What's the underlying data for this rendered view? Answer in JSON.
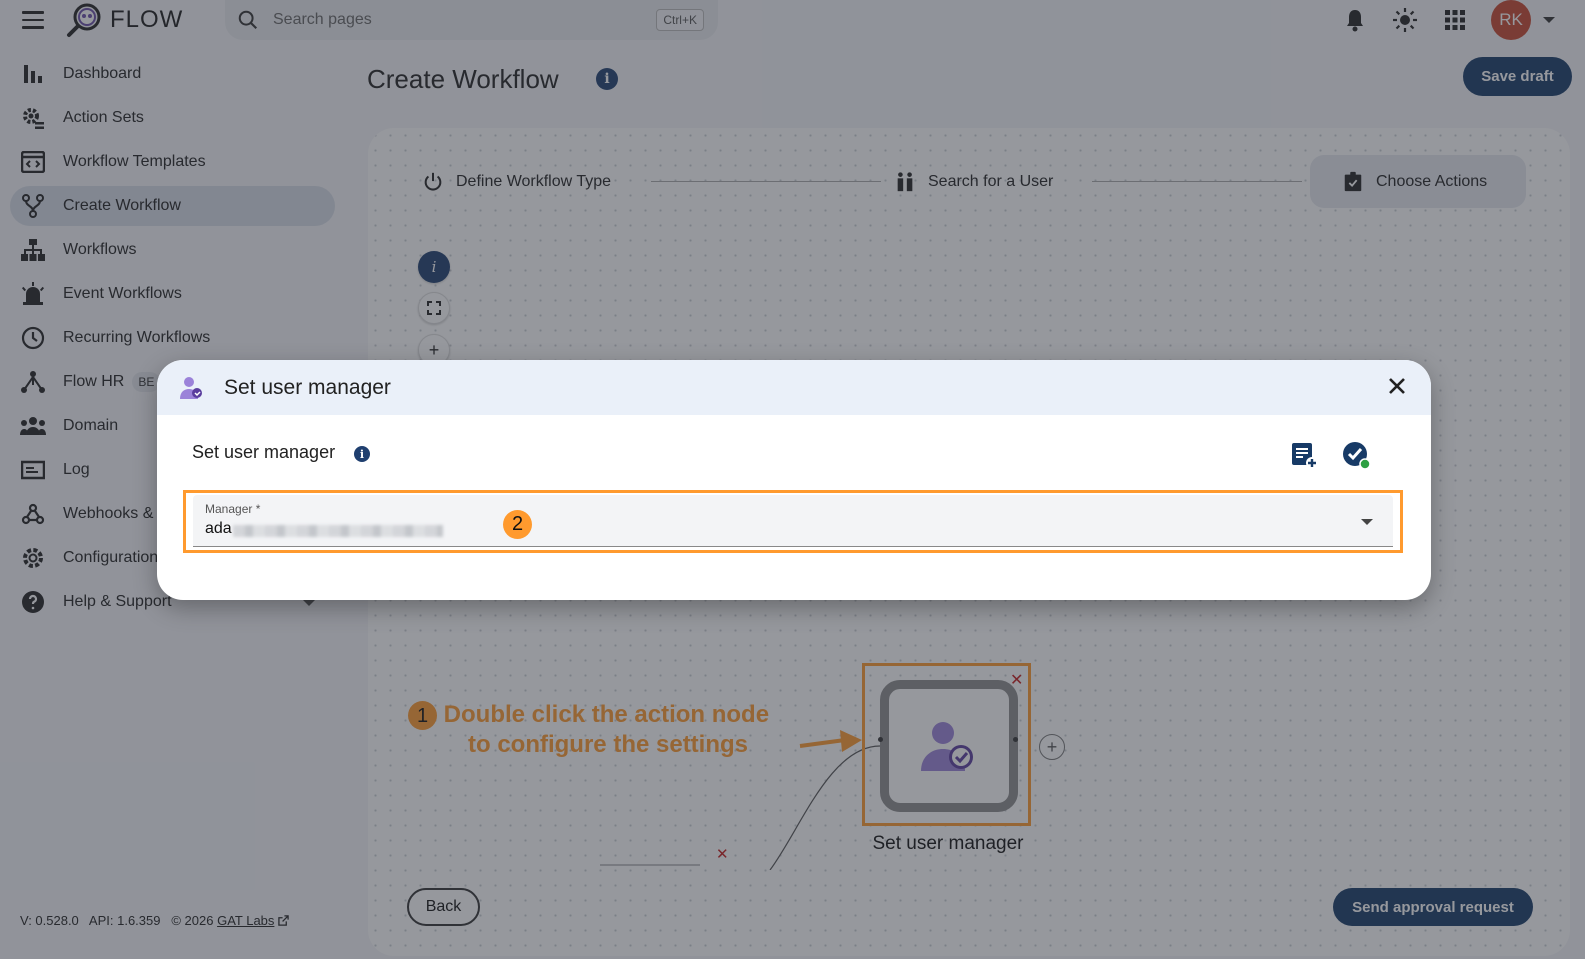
{
  "app": {
    "name": "FLOW"
  },
  "search": {
    "placeholder": "Search pages",
    "shortcut": "Ctrl+K"
  },
  "user": {
    "initials": "RK"
  },
  "sidebar": {
    "items": [
      {
        "label": "Dashboard",
        "icon": "bar-chart-icon"
      },
      {
        "label": "Action Sets",
        "icon": "gear-list-icon"
      },
      {
        "label": "Workflow Templates",
        "icon": "template-icon"
      },
      {
        "label": "Create Workflow",
        "icon": "fork-icon",
        "active": true
      },
      {
        "label": "Workflows",
        "icon": "hierarchy-icon"
      },
      {
        "label": "Event Workflows",
        "icon": "siren-icon"
      },
      {
        "label": "Recurring Workflows",
        "icon": "clock-icon"
      },
      {
        "label": "Flow HR",
        "icon": "hr-icon",
        "badge": "BE"
      },
      {
        "label": "Domain",
        "icon": "people-icon"
      },
      {
        "label": "Log",
        "icon": "log-icon"
      },
      {
        "label": "Webhooks &",
        "icon": "webhook-icon"
      },
      {
        "label": "Configuration",
        "icon": "settings-icon"
      },
      {
        "label": "Help & Support",
        "icon": "help-icon"
      }
    ]
  },
  "footer": {
    "version": "V: 0.528.0",
    "api": "API: 1.6.359",
    "copyright": "© 2026",
    "link": "GAT Labs"
  },
  "page": {
    "title": "Create Workflow",
    "save_draft": "Save draft"
  },
  "stepper": {
    "steps": [
      {
        "label": "Define Workflow Type"
      },
      {
        "label": "Search for a User"
      },
      {
        "label": "Choose Actions"
      }
    ]
  },
  "canvas": {
    "node_label": "Set user manager",
    "annotation_number": "1",
    "annotation_line1": "Double click the action node",
    "annotation_line2": "to configure the settings"
  },
  "buttons": {
    "back": "Back",
    "send": "Send approval request"
  },
  "dialog": {
    "title": "Set user manager",
    "section_title": "Set user manager",
    "field_label": "Manager *",
    "field_value": "ada",
    "annotation_number": "2"
  },
  "colors": {
    "primary": "#173a66",
    "accent": "#ff9a2e",
    "avatar": "#c6462f",
    "danger": "#c51a1a"
  }
}
